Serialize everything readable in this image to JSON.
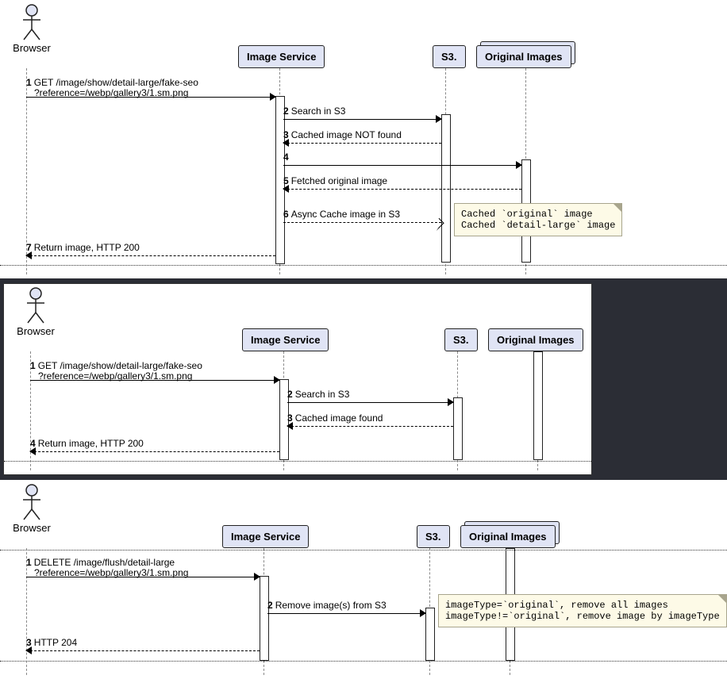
{
  "participants": {
    "browser": "Browser",
    "image_service": "Image Service",
    "s3": "S3.",
    "original_images": "Original Images"
  },
  "diagrams": [
    {
      "id": "cache-miss",
      "messages": [
        {
          "n": "1",
          "from": "browser",
          "to": "image_service",
          "style": "solid",
          "text_lines": [
            "GET /image/show/detail-large/fake-seo",
            "?reference=/webp/gallery3/1.sm.png"
          ]
        },
        {
          "n": "2",
          "from": "image_service",
          "to": "s3",
          "style": "solid",
          "text": "Search in S3"
        },
        {
          "n": "3",
          "from": "s3",
          "to": "image_service",
          "style": "dashed",
          "text": "Cached image NOT found"
        },
        {
          "n": "4",
          "from": "image_service",
          "to": "original_images",
          "style": "solid",
          "text": ""
        },
        {
          "n": "5",
          "from": "original_images",
          "to": "image_service",
          "style": "dashed",
          "text": "Fetched original image"
        },
        {
          "n": "6",
          "from": "image_service",
          "to": "s3",
          "style": "dashed-open",
          "text": "Async Cache image in S3"
        },
        {
          "n": "7",
          "from": "image_service",
          "to": "browser",
          "style": "dashed",
          "text": "Return image, HTTP 200"
        }
      ],
      "notes": [
        {
          "at_msg": "6",
          "text_lines": [
            "Cached `original` image",
            "Cached `detail-large` image"
          ]
        }
      ]
    },
    {
      "id": "cache-hit",
      "messages": [
        {
          "n": "1",
          "from": "browser",
          "to": "image_service",
          "style": "solid",
          "text_lines": [
            "GET /image/show/detail-large/fake-seo",
            "?reference=/webp/gallery3/1.sm.png"
          ]
        },
        {
          "n": "2",
          "from": "image_service",
          "to": "s3",
          "style": "solid",
          "text": "Search in S3"
        },
        {
          "n": "3",
          "from": "s3",
          "to": "image_service",
          "style": "dashed",
          "text": "Cached image found"
        },
        {
          "n": "4",
          "from": "image_service",
          "to": "browser",
          "style": "dashed",
          "text": "Return image, HTTP 200"
        }
      ],
      "notes": []
    },
    {
      "id": "flush",
      "messages": [
        {
          "n": "1",
          "from": "browser",
          "to": "image_service",
          "style": "solid",
          "text_lines": [
            "DELETE /image/flush/detail-large",
            "?reference=/webp/gallery3/1.sm.png"
          ]
        },
        {
          "n": "2",
          "from": "image_service",
          "to": "s3",
          "style": "solid",
          "text": "Remove image(s) from S3"
        },
        {
          "n": "3",
          "from": "image_service",
          "to": "browser",
          "style": "dashed",
          "text": "HTTP 204"
        }
      ],
      "notes": [
        {
          "at_msg": "2",
          "text_lines": [
            "imageType=`original`, remove all images",
            "imageType!=`original`, remove image by imageType"
          ]
        }
      ]
    }
  ]
}
